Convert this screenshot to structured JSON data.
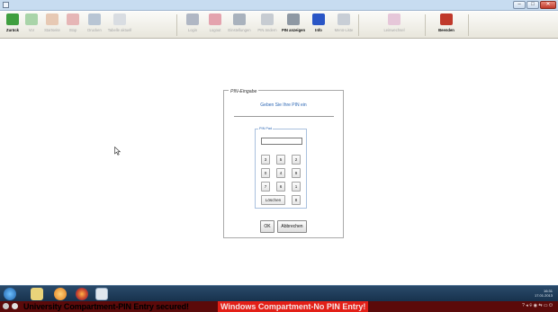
{
  "toolbar": {
    "items": [
      {
        "label": "Zurück",
        "icon": "back-arrow-icon",
        "color": "#3f9f3f",
        "active": true
      },
      {
        "label": "Vor",
        "icon": "forward-arrow-icon",
        "color": "#a9d4a9",
        "active": false
      },
      {
        "label": "Startseite",
        "icon": "home-icon",
        "color": "#e7c9b4",
        "active": false
      },
      {
        "label": "Stop",
        "icon": "stop-icon",
        "color": "#e6b6b6",
        "active": false
      },
      {
        "label": "Drucken",
        "icon": "printer-icon",
        "color": "#b8c5d4",
        "active": false
      },
      {
        "label": "Tabelle aktuell",
        "icon": "weather-icon",
        "color": "#d9dde2",
        "active": false
      },
      {
        "label": "Login",
        "icon": "users-icon",
        "color": "#b0b7c4",
        "active": false
      },
      {
        "label": "Logout",
        "icon": "logout-icon",
        "color": "#e4a3ae",
        "active": false
      },
      {
        "label": "Einstellungen",
        "icon": "tools-icon",
        "color": "#a9b2bd",
        "active": false
      },
      {
        "label": "PIN ändern",
        "icon": "pin-change-icon",
        "color": "#c7ccd2",
        "active": false
      },
      {
        "label": "PIN anzeigen",
        "icon": "pin-show-icon",
        "color": "#8e98a3",
        "active": true
      },
      {
        "label": "Info",
        "icon": "info-icon",
        "color": "#2a56c6",
        "active": true
      },
      {
        "label": "Menü-Liste",
        "icon": "folder-icon",
        "color": "#c8ced6",
        "active": false
      },
      {
        "label": "Leinwechsel",
        "icon": "switch-icon",
        "color": "#e6c7d9",
        "active": false
      },
      {
        "label": "Beenden",
        "icon": "exit-icon",
        "color": "#c0392b",
        "active": true
      }
    ]
  },
  "dialog": {
    "title": "PIN-Eingabe",
    "prompt": "Geben Sie Ihre PIN ein",
    "pad_title": "PIN Pad",
    "pin_value": "",
    "keys": [
      "3",
      "5",
      "2",
      "0",
      "4",
      "9",
      "7",
      "6",
      "1",
      "Löschen",
      "8"
    ],
    "ok_label": "OK",
    "cancel_label": "Abbrechen"
  },
  "tray": {
    "time": "16:31",
    "date": "17.01.2013"
  },
  "status": {
    "secured": "University Compartment-PIN Entry secured!",
    "warning": "Windows Compartment-No PIN Entry!",
    "warning_color": "#e31f17"
  }
}
